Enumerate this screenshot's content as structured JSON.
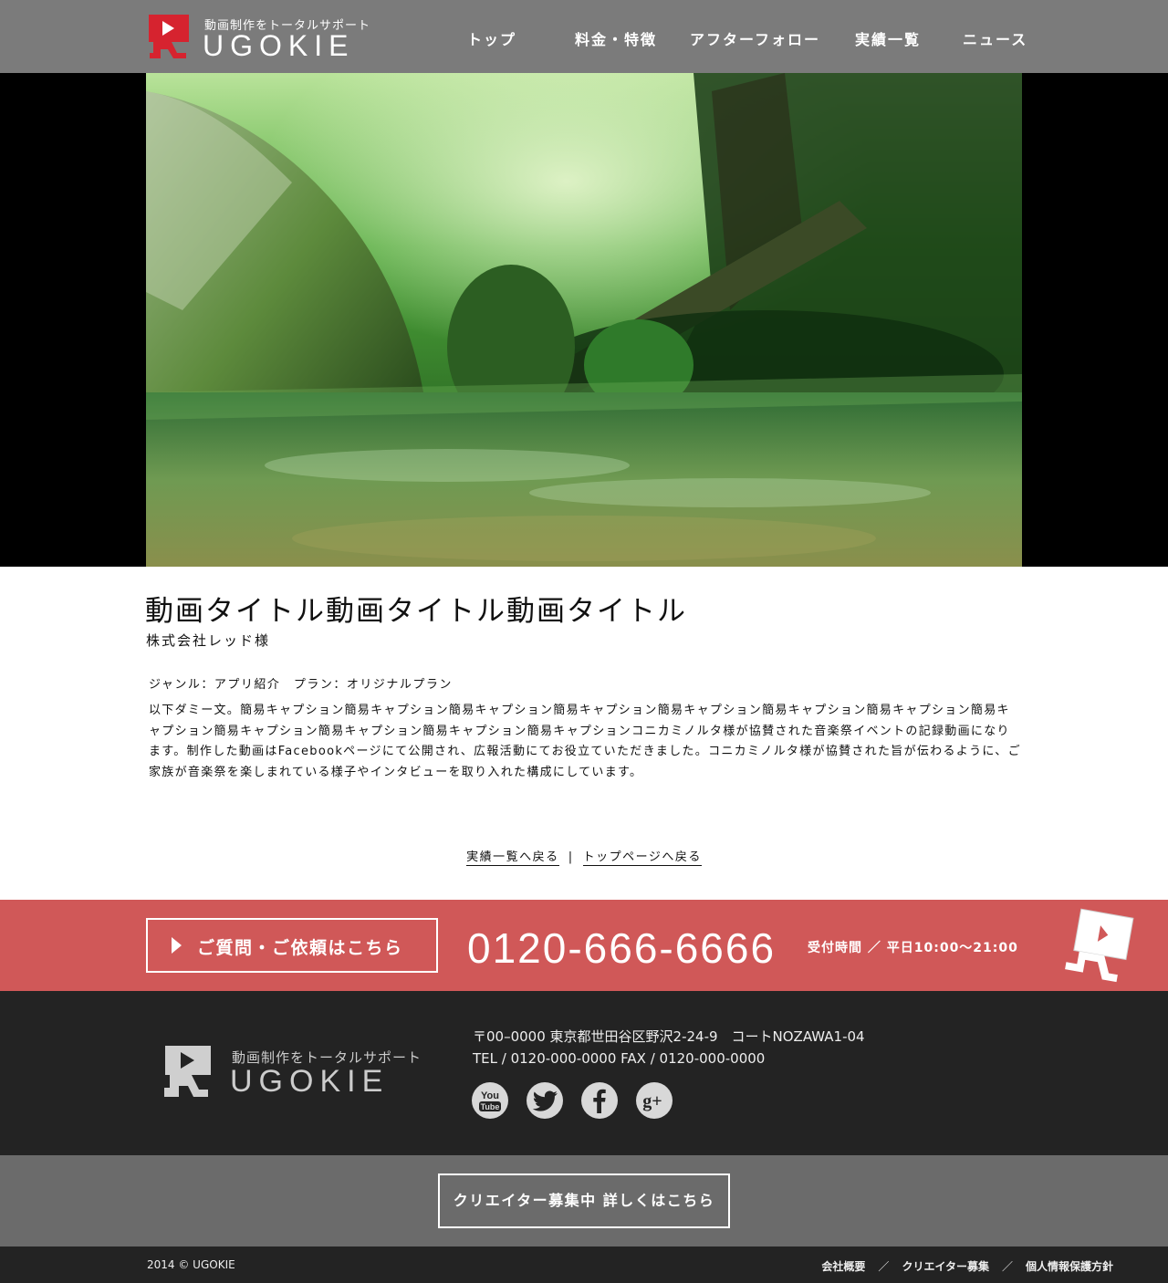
{
  "header": {
    "logo_tagline": "動画制作をトータルサポート",
    "logo_word": "UGOKIE",
    "nav": [
      "トップ",
      "料金・特徴",
      "アフターフォロー",
      "実績一覧",
      "ニュース"
    ]
  },
  "work": {
    "title": "動画タイトル動画タイトル動画タイトル",
    "client": "株式会社レッド様",
    "meta": "ジャンル：アプリ紹介　プラン：オリジナルプラン",
    "description": "以下ダミー文。簡易キャプション簡易キャプション簡易キャプション簡易キャプション簡易キャプション簡易キャプション簡易キャプション簡易キャプション簡易キャプション簡易キャプション簡易キャプション簡易キャプションコニカミノルタ様が協賛された音楽祭イベントの記録動画になります。制作した動画はFacebookページにて公開され、広報活動にてお役立ていただきました。コニカミノルタ様が協賛された旨が伝わるように、ご家族が音楽祭を楽しまれている様子やインタビューを取り入れた構成にしています。"
  },
  "back_links": {
    "works": "実績一覧へ戻る",
    "separator": "|",
    "top": "トップページへ戻る"
  },
  "contact": {
    "button_label": "ご質問・ご依頼はこちら",
    "phone": "0120-666-6666",
    "hours": "受付時間 ／ 平日10:00〜21:00"
  },
  "footer": {
    "logo_tagline": "動画制作をトータルサポート",
    "logo_word": "UGOKIE",
    "address": "〒00–0000 東京都世田谷区野沢2-24-9　コートNOZAWA1-04",
    "tel_fax": "TEL / 0120-000-0000  FAX / 0120-000-0000",
    "social": [
      "youtube",
      "twitter",
      "facebook",
      "google-plus"
    ],
    "youtube_label_1": "You",
    "youtube_label_2": "Tube",
    "gplus_label": "g+"
  },
  "creator": {
    "button_label": "クリエイター募集中 詳しくはこちら"
  },
  "bottom": {
    "copyright": "2014 © UGOKIE",
    "links": [
      "会社概要",
      "クリエイター募集",
      "個人情報保護方針"
    ],
    "separator": "／"
  },
  "colors": {
    "header_bg": "#7b7b7b",
    "contact_bg": "#d05858",
    "footer_bg": "#232323",
    "creator_bg": "#6b6b6b",
    "logo_red": "#d6232f"
  }
}
